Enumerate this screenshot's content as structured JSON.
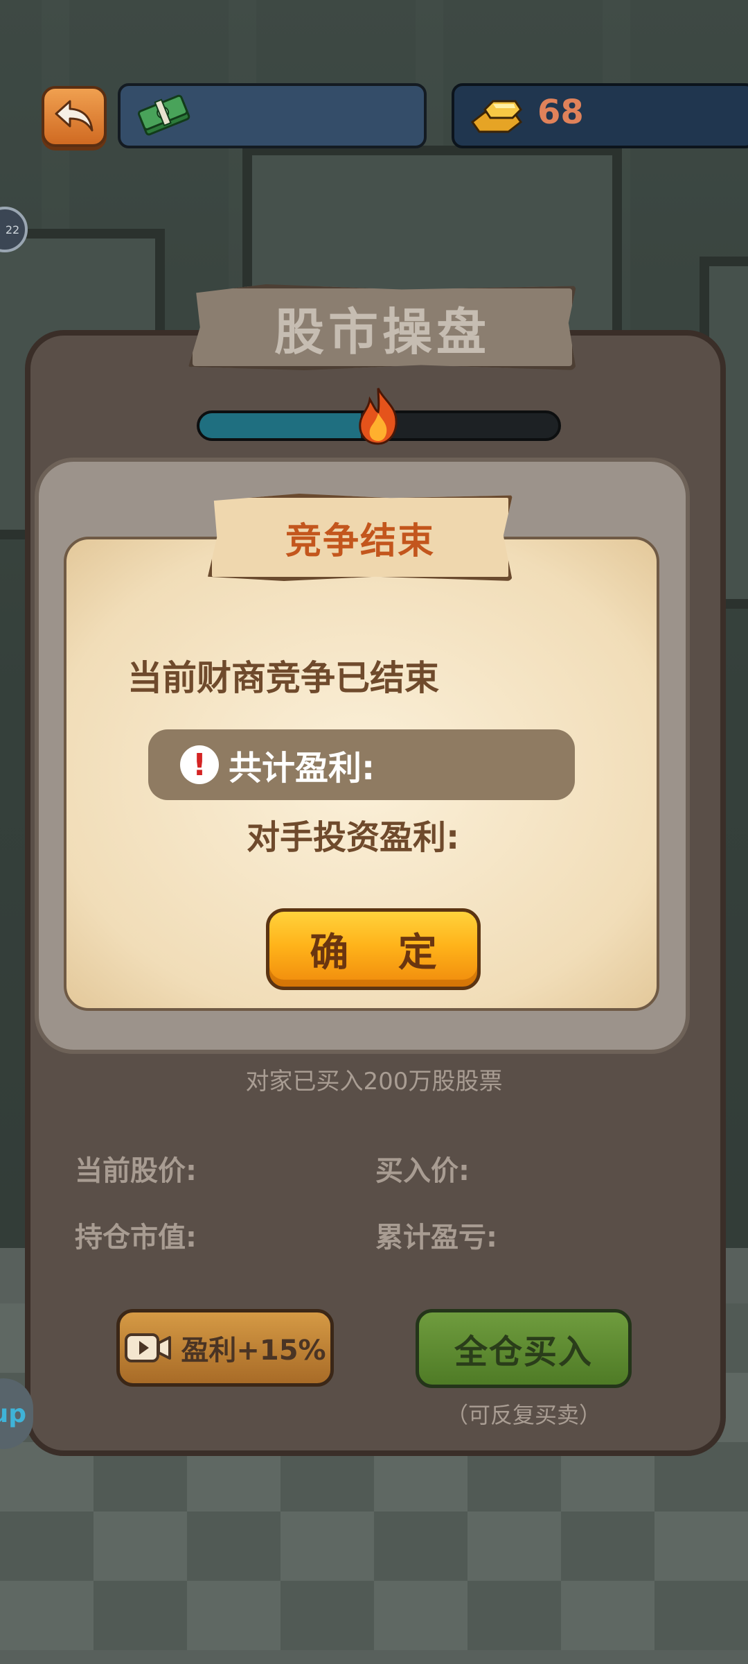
{
  "top_bar": {
    "cash_value": "",
    "gold_value": "68"
  },
  "icons": {
    "back": "back-arrow-icon",
    "cash": "money-stack-icon",
    "gold": "gold-bar-icon",
    "flame": "flame-icon",
    "warning": "warning-icon",
    "video": "video-icon"
  },
  "side": {
    "badge_text": "22",
    "up_text": "up"
  },
  "main": {
    "title": "股市操盘",
    "progress": 0.45,
    "opponent_note": "对家已买入200万股股票",
    "stats": {
      "current_price_label": "当前股价:",
      "buy_price_label": "买入价:",
      "holding_value_label": "持仓市值:",
      "cumulative_pl_label": "累计盈亏:"
    },
    "boost_button": "盈利+15%",
    "buy_button": "全仓买入",
    "buy_note": "（可反复买卖）"
  },
  "modal": {
    "title": "竞争结束",
    "message": "当前财商竞争已结束",
    "total_profit_label": "共计盈利:",
    "opponent_profit_label": "对手投资盈利:",
    "confirm_button": "确 定"
  },
  "colors": {
    "panel": "#5a4f48",
    "progress_fill": "#1f6f80",
    "confirm_button": "#ffb31a",
    "buy_button": "#6f9c3e",
    "boost_button": "#d59a45"
  }
}
